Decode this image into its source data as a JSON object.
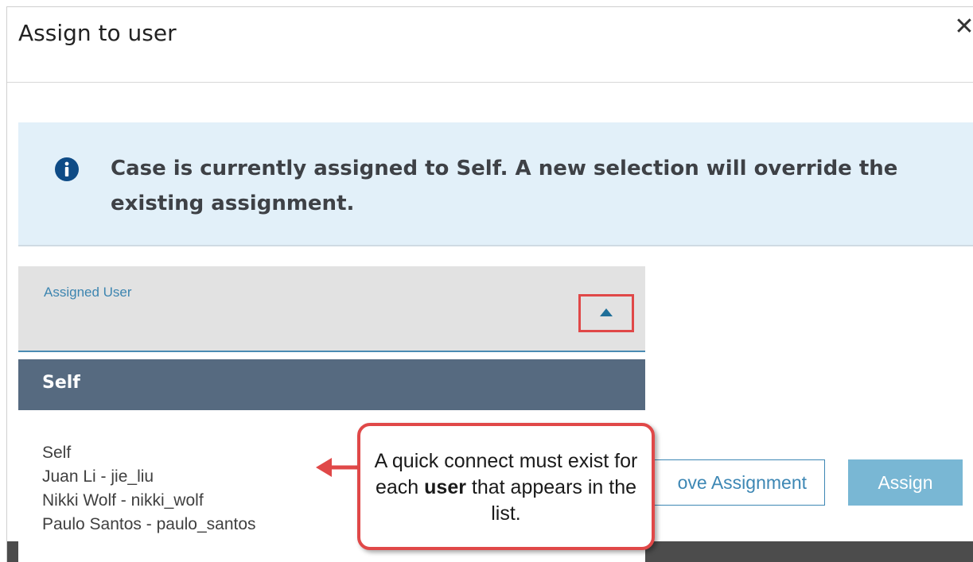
{
  "dialog": {
    "title": "Assign to user",
    "close_glyph": "✕"
  },
  "alert": {
    "icon": "info-icon",
    "message": "Case is currently assigned to Self. A new selection will override the existing assignment."
  },
  "assigned_user": {
    "label": "Assigned User",
    "selected": "Self",
    "options": [
      "Self",
      "Juan Li - jie_liu",
      "Nikki Wolf - nikki_wolf",
      "Paulo Santos - paulo_santos"
    ]
  },
  "actions": {
    "remove_label": "ove Assignment",
    "assign_label": "Assign"
  },
  "callout": {
    "text_before": "A quick connect must exist for each ",
    "text_bold": "user",
    "text_after": " that appears in the list."
  },
  "colors": {
    "accent": "#3d87b4",
    "highlight": "#e04848",
    "selected_bg": "#566a80",
    "alert_bg": "#e2f0f9"
  }
}
